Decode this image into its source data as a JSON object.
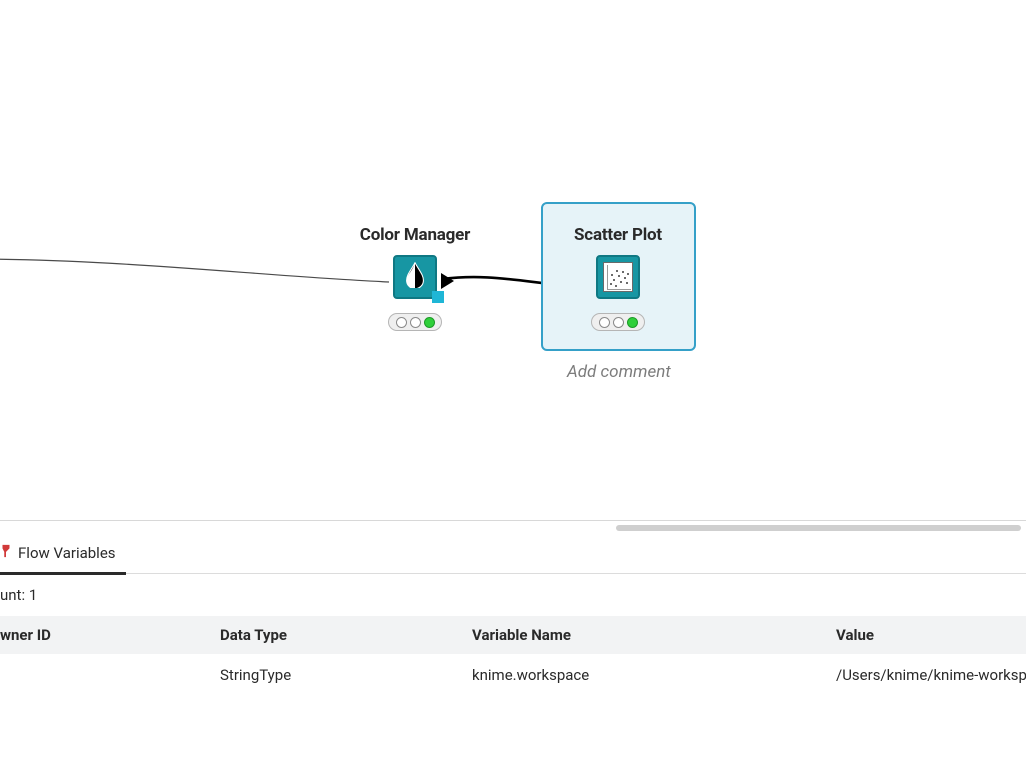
{
  "workflow": {
    "nodes": {
      "colorManager": {
        "title": "Color Manager",
        "status": "executed"
      },
      "scatterPlot": {
        "title": "Scatter Plot",
        "status": "executed",
        "selected": true
      }
    },
    "addCommentHint": "Add comment"
  },
  "panel": {
    "tabs": [
      {
        "id": "flow-variables",
        "label": "Flow Variables",
        "active": true
      }
    ],
    "countLabel": "unt: 1",
    "columns": {
      "ownerId": "wner ID",
      "dataType": "Data Type",
      "variableName": "Variable Name",
      "value": "Value"
    },
    "rows": [
      {
        "ownerId": "",
        "dataType": "StringType",
        "variableName": "knime.workspace",
        "value": "/Users/knime/knime-workspace"
      }
    ]
  }
}
